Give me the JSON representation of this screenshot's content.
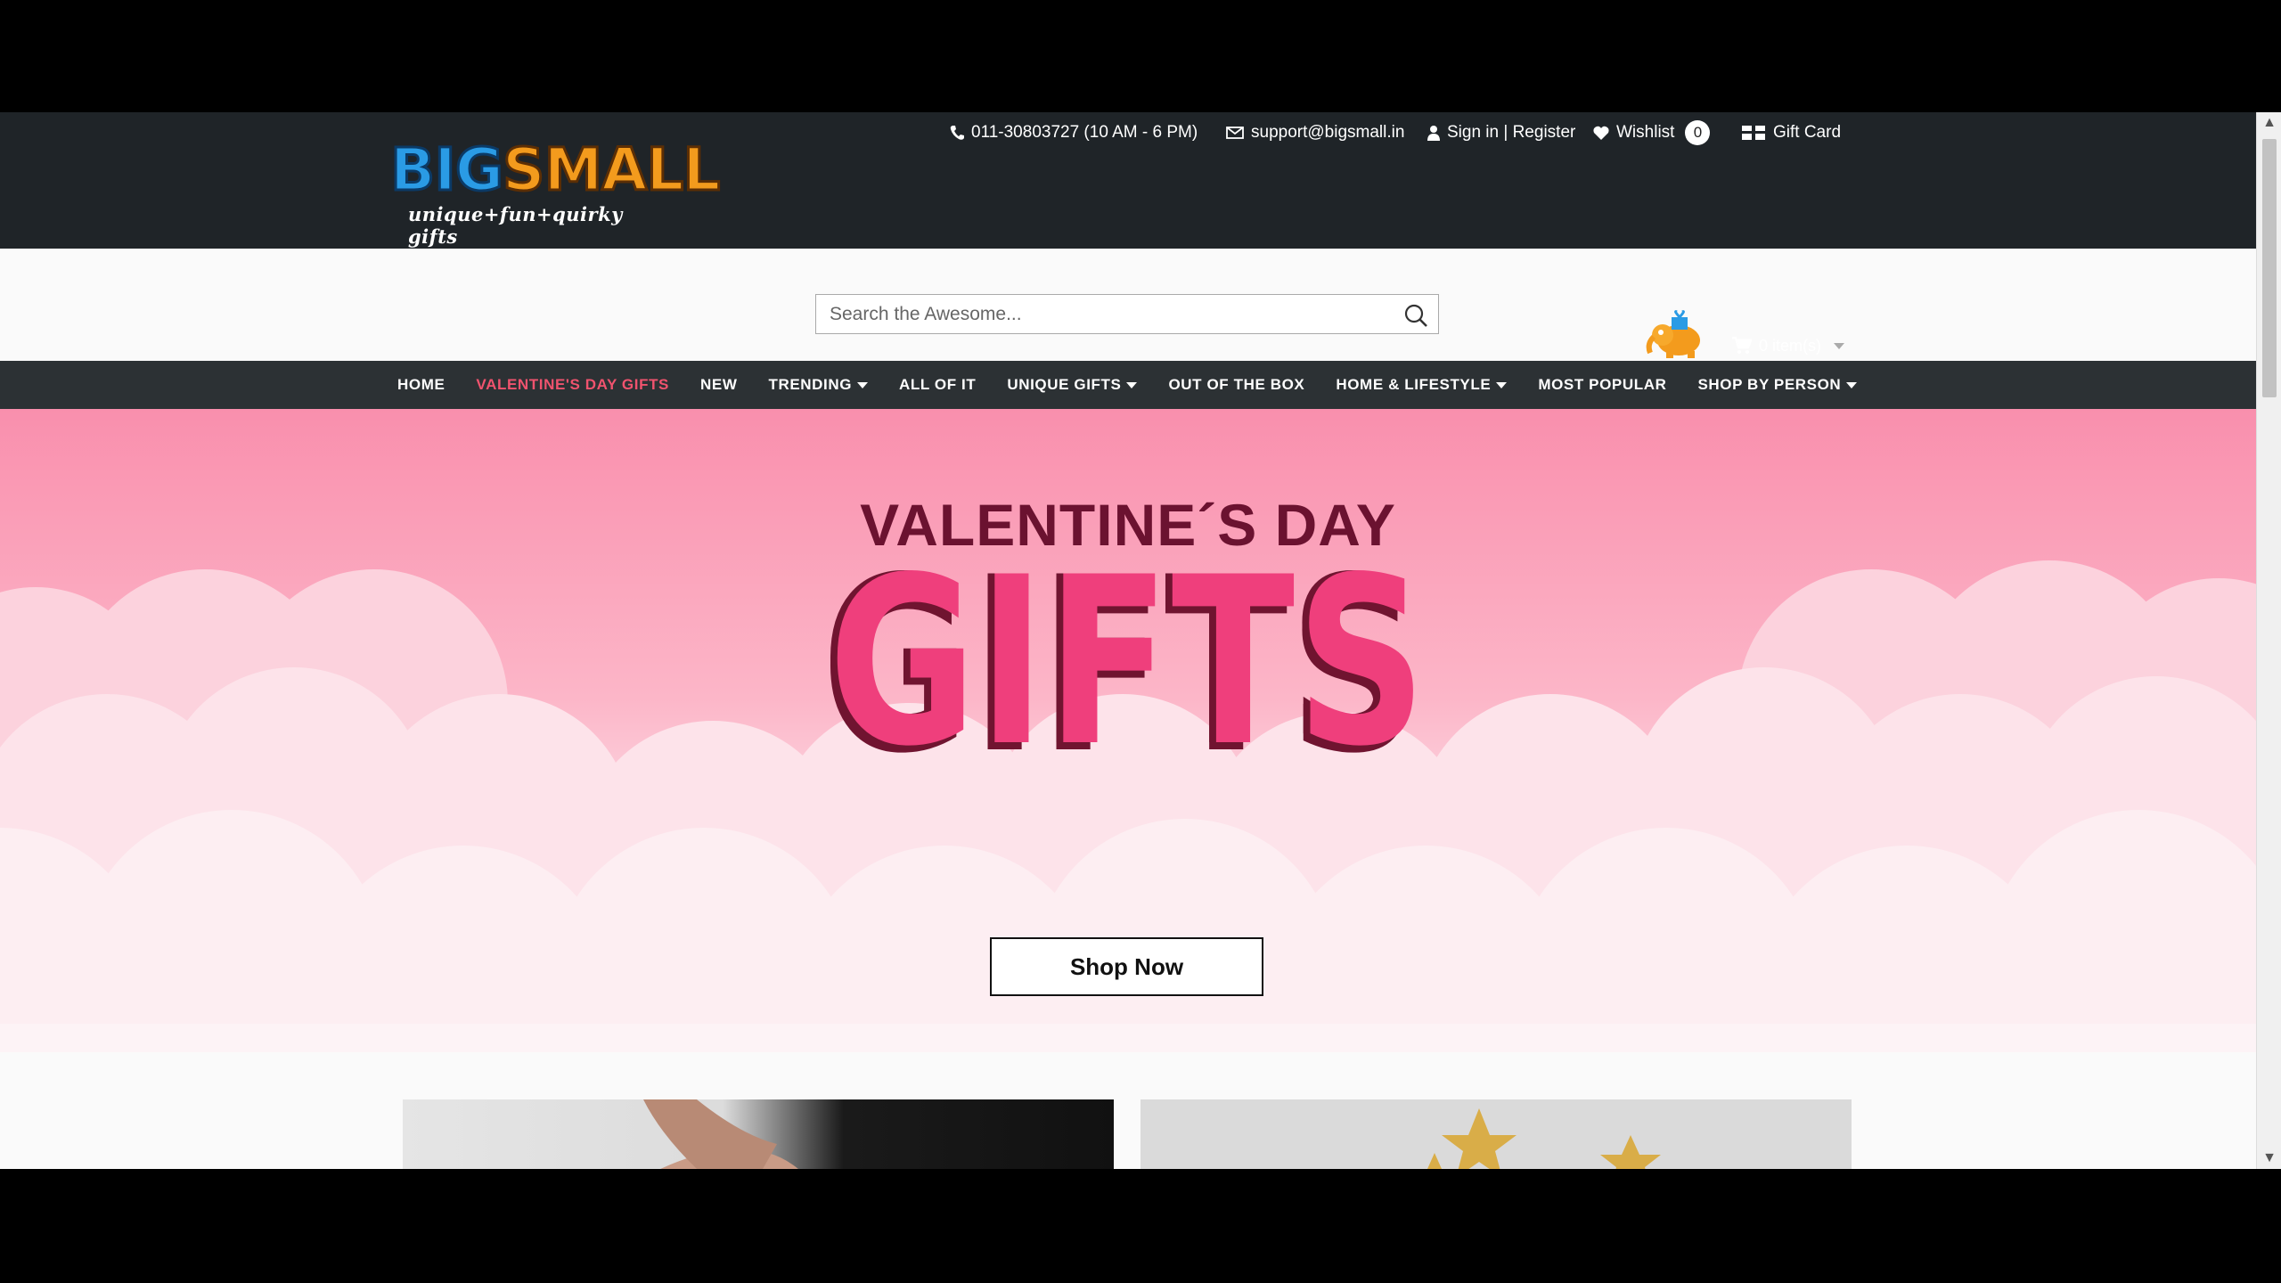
{
  "logo": {
    "word_big": "BIG",
    "word_small": "SMALL",
    "tagline": "unique+fun+quirky gifts"
  },
  "topbar": {
    "phone": "011-30803727 (10 AM - 6 PM)",
    "email": "support@bigsmall.in",
    "account": "Sign in | Register",
    "wishlist_label": "Wishlist",
    "wishlist_count": "0",
    "gift_card": "Gift Card"
  },
  "search": {
    "placeholder": "Search the Awesome..."
  },
  "cart": {
    "label": "0 item(s)"
  },
  "nav": {
    "items": [
      {
        "label": "HOME"
      },
      {
        "label": "VALENTINE'S DAY GIFTS"
      },
      {
        "label": "NEW"
      },
      {
        "label": "TRENDING"
      },
      {
        "label": "ALL OF IT"
      },
      {
        "label": "UNIQUE GIFTS"
      },
      {
        "label": "OUT OF THE BOX"
      },
      {
        "label": "HOME & LIFESTYLE"
      },
      {
        "label": "MOST POPULAR"
      },
      {
        "label": "SHOP BY PERSON"
      }
    ]
  },
  "hero": {
    "subtitle": "VALENTINE´S DAY",
    "title": "GIFTS",
    "cta": "Shop Now"
  },
  "colors": {
    "header_bg": "#1f2428",
    "nav_bg": "#2c3134",
    "nav_active": "#f0536e",
    "hero_pink": "#ef3f7c",
    "hero_dark": "#6b1230"
  }
}
